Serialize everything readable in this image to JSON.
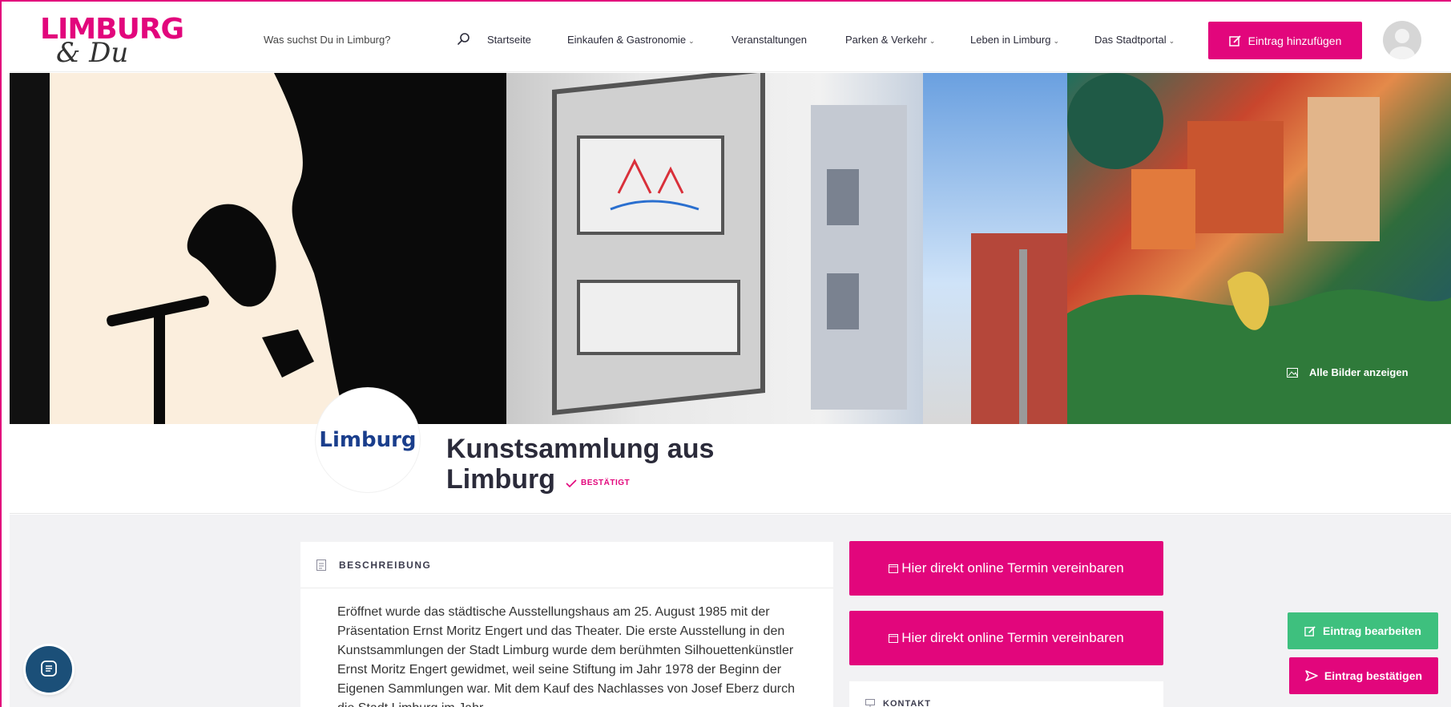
{
  "brand": {
    "primary_color": "#e2067c",
    "line1": "LIMBURG",
    "line2": "& Du"
  },
  "header": {
    "search_placeholder": "Was suchst Du in Limburg?",
    "nav": [
      {
        "label": "Startseite",
        "has_dropdown": false
      },
      {
        "label": "Einkaufen & Gastronomie",
        "has_dropdown": true
      },
      {
        "label": "Veranstaltungen",
        "has_dropdown": false
      },
      {
        "label": "Parken & Verkehr",
        "has_dropdown": true
      },
      {
        "label": "Leben in Limburg",
        "has_dropdown": true
      },
      {
        "label": "Das Stadtportal",
        "has_dropdown": true
      }
    ],
    "add_entry_label": "Eintrag hinzufügen"
  },
  "hero": {
    "all_images_label": "Alle Bilder anzeigen"
  },
  "listing": {
    "logo_text": "Limburg",
    "title": "Kunstsammlung aus Limburg",
    "verified_label": "BESTÄTIGT"
  },
  "description": {
    "heading": "BESCHREIBUNG",
    "text": "Eröffnet wurde das städtische Ausstellungshaus am 25. August 1985 mit der Präsentation Ernst Moritz Engert und das Theater. Die erste Ausstellung in den Kunstsammlungen der Stadt Limburg wurde dem berühmten Silhouettenkünstler Ernst Moritz Engert gewidmet, weil seine Stiftung im Jahr 1978 der Beginn der Eigenen Sammlungen war. Mit dem Kauf des Nachlasses von Josef Eberz durch die Stadt Limburg im Jahr"
  },
  "sidebar": {
    "termin_buttons": [
      "Hier direkt online Termin vereinbaren",
      "Hier direkt online Termin vereinbaren"
    ],
    "kontakt_heading": "KONTAKT"
  },
  "actions": {
    "edit_label": "Eintrag bearbeiten",
    "confirm_label": "Eintrag bestätigen",
    "edit_color": "#3ec07e"
  }
}
